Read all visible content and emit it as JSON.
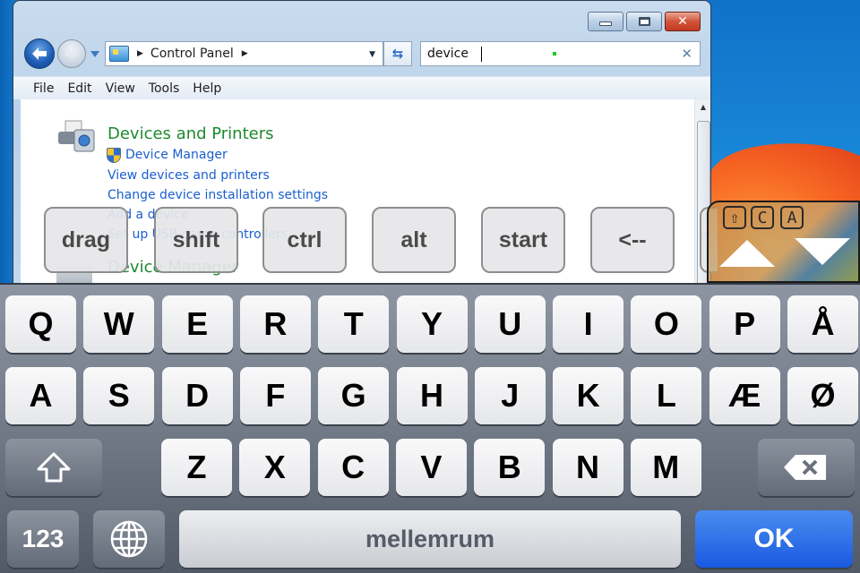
{
  "window": {
    "controls": {
      "minimize": "minimize",
      "maximize": "maximize",
      "close": "✕"
    },
    "address": {
      "crumbs": [
        "Control Panel"
      ],
      "separator": "▶",
      "dropdown": "▼"
    },
    "refresh_label": "⇆",
    "search": {
      "value": "device",
      "clear": "✕"
    },
    "menu": [
      "File",
      "Edit",
      "View",
      "Tools",
      "Help"
    ],
    "results": {
      "category_title": "Devices and Printers",
      "links": [
        "Device Manager",
        "View devices and printers",
        "Change device installation settings",
        "Add a device",
        "Set up USB game controllers"
      ],
      "links_visible": [
        "Device Manager",
        "View devices and printers",
        "Change device installation settings",
        "a dev",
        "p USB",
        "ollers"
      ],
      "category_title_2": "Device Manager"
    },
    "scrollbar": {
      "up": "▲",
      "grip": "≡"
    }
  },
  "overlay_keys": [
    "drag",
    "shift",
    "ctrl",
    "alt",
    "start",
    "<--"
  ],
  "scroll_panel": {
    "modifiers": [
      "⇧",
      "C",
      "A"
    ]
  },
  "keyboard": {
    "row1": [
      "Q",
      "W",
      "E",
      "R",
      "T",
      "Y",
      "U",
      "I",
      "O",
      "P",
      "Å"
    ],
    "row2": [
      "A",
      "S",
      "D",
      "F",
      "G",
      "H",
      "J",
      "K",
      "L",
      "Æ",
      "Ø"
    ],
    "row3": [
      "Z",
      "X",
      "C",
      "V",
      "B",
      "N",
      "M"
    ],
    "numbers_label": "123",
    "space_label": "mellemrum",
    "return_label": "OK"
  },
  "colors": {
    "ok_key": "#1a5ae0",
    "link": "#1a5fcf",
    "category": "#1e8a2e"
  }
}
